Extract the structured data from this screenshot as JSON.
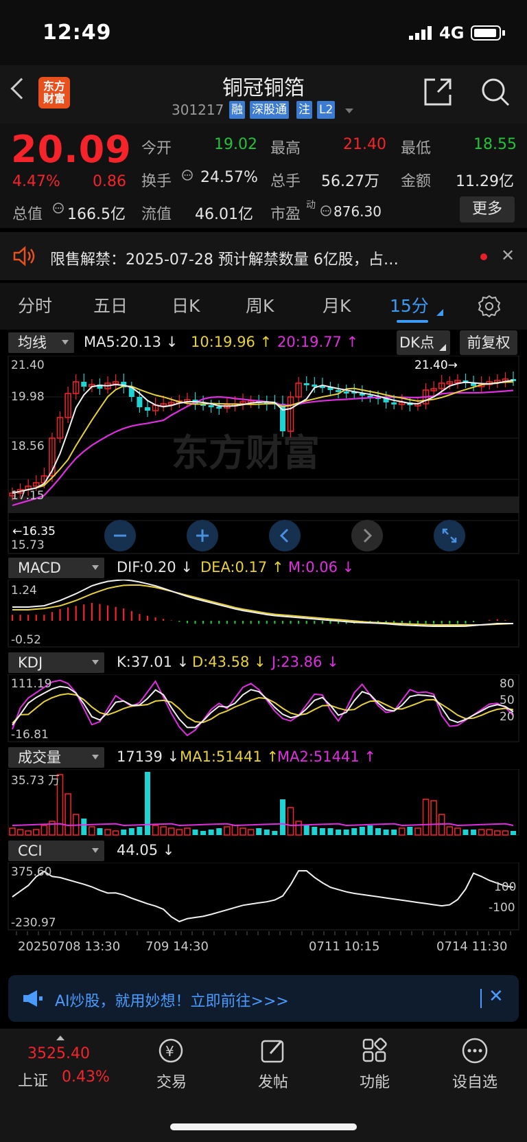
{
  "status_bar": {
    "time": "12:49",
    "network": "4G"
  },
  "header": {
    "logo_text": "东方\n财富",
    "name": "铜冠铜箔",
    "code": "301217",
    "tags": [
      "融",
      "深股通",
      "注",
      "L2"
    ]
  },
  "quote": {
    "price": "20.09",
    "change_pct": "4.47%",
    "change": "0.86",
    "total_value_label": "总值",
    "total_value": "166.5亿",
    "open_label": "今开",
    "open": "19.02",
    "high_label": "最高",
    "high": "21.40",
    "low_label": "最低",
    "low": "18.55",
    "turnover_label": "换手",
    "turnover": "24.57%",
    "volume_label": "总手",
    "volume": "56.27万",
    "amount_label": "金额",
    "amount": "11.29亿",
    "float_label": "流值",
    "float_value": "46.01亿",
    "pe_label": "市盈",
    "pe_sup": "动",
    "pe": "876.30",
    "more_label": "更多"
  },
  "notice": {
    "text": "限售解禁：2025-07-28 预计解禁数量 6亿股，占…"
  },
  "tabs": [
    "分时",
    "五日",
    "日K",
    "周K",
    "月K",
    "15分"
  ],
  "active_tab": 5,
  "main_chart": {
    "dropdown": "均线",
    "ma5": "MA5:20.13",
    "ma10": "10:19.96",
    "ma20": "20:19.77",
    "dk_label": "DK点",
    "fq_label": "前复权",
    "y_labels": [
      "21.40",
      "19.98",
      "18.56",
      "17.15",
      "15.73"
    ],
    "high_marker": "21.40→",
    "low_marker": "←16.35",
    "watermark": "东方财富"
  },
  "macd": {
    "dropdown": "MACD",
    "dif": "DIF:0.20",
    "dea": "DEA:0.17",
    "m": "M:0.06",
    "y_top": "1.24",
    "y_bottom": "-0.52"
  },
  "kdj": {
    "dropdown": "KDJ",
    "k": "K:37.01",
    "d": "D:43.58",
    "j": "J:23.86",
    "y_top": "111.19",
    "y_bottom": "-16.81",
    "levels": [
      "80",
      "50",
      "20"
    ]
  },
  "volume_panel": {
    "dropdown": "成交量",
    "vol": "17139",
    "ma1": "MA1:51441",
    "ma2": "MA2:51441",
    "y_top": "35.73 万"
  },
  "cci": {
    "dropdown": "CCI",
    "value": "44.05",
    "y_top": "375.60",
    "y_bottom": "-230.97",
    "levels": [
      "100",
      "-100"
    ]
  },
  "x_axis": [
    "20250708 13:30",
    "709 14:30",
    "0711 10:15",
    "0714 11:30"
  ],
  "ai_banner": {
    "text": "AI炒股，就用妙想！立即前往>>>"
  },
  "nav": {
    "index_value": "3525.40",
    "index_name": "上证",
    "index_change": "0.43%",
    "items": [
      "交易",
      "发帖",
      "功能",
      "设自选"
    ]
  },
  "colors": {
    "up": "#f5242b",
    "down": "#22c33a",
    "accent": "#3b9bf5",
    "ma5": "#ffffff",
    "ma10": "#e8d23a",
    "ma20": "#e02fe0",
    "cyan": "#1fd3d3"
  }
}
